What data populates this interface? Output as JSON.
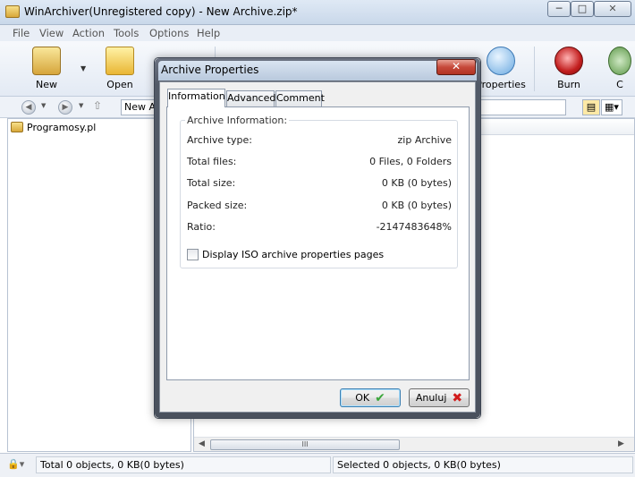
{
  "window": {
    "title": "WinArchiver(Unregistered copy) - New Archive.zip*",
    "minimize_glyph": "─",
    "maximize_glyph": "□",
    "close_glyph": "✕"
  },
  "menu": [
    "File",
    "View",
    "Action",
    "Tools",
    "Options",
    "Help"
  ],
  "toolbar": {
    "new_label": "New",
    "open_label": "Open",
    "properties_label": "Properties",
    "burn_label": "Burn",
    "c_label": "C"
  },
  "addressbar": {
    "value": "New Ar"
  },
  "tree": {
    "root_label": "Programosy.pl"
  },
  "scrollbar": {
    "thumb_grip": "III"
  },
  "status": {
    "left": "Total 0 objects, 0 KB(0 bytes)",
    "right": "Selected 0 objects, 0 KB(0 bytes)"
  },
  "dialog": {
    "title": "Archive Properties",
    "tabs": [
      "Information",
      "Advanced",
      "Comment"
    ],
    "group_title": "Archive Information:",
    "rows": [
      {
        "label": "Archive type:",
        "value": "zip Archive"
      },
      {
        "label": "Total files:",
        "value": "0 Files, 0 Folders"
      },
      {
        "label": "Total size:",
        "value": "0 KB (0 bytes)"
      },
      {
        "label": "Packed size:",
        "value": "0 KB (0 bytes)"
      },
      {
        "label": "Ratio:",
        "value": "-2147483648%"
      }
    ],
    "checkbox_label": "Display ISO archive properties pages",
    "ok_label": "OK",
    "cancel_label": "Anuluj"
  },
  "colors": {
    "accent": "#3c7fb1",
    "close_red": "#c6493a",
    "ok_green": "#3aa63a",
    "cancel_red": "#d11b1b"
  }
}
